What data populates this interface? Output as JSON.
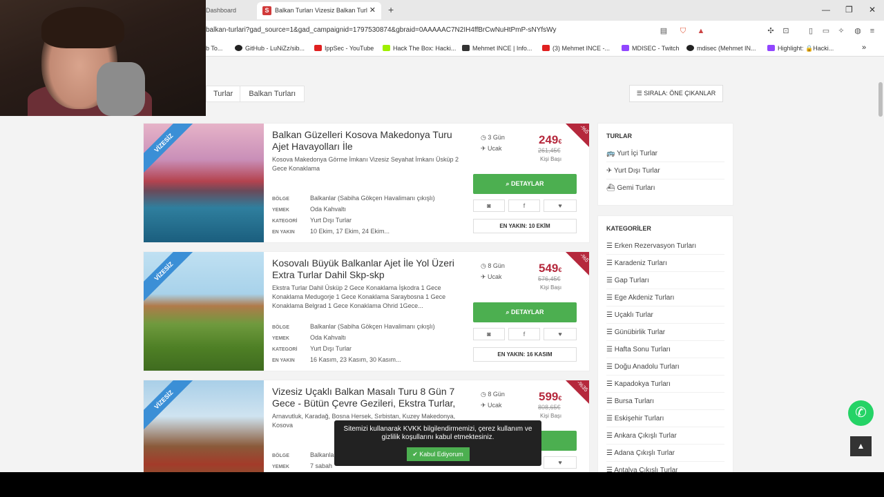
{
  "browser": {
    "tabs": [
      {
        "label": "Dashboard"
      },
      {
        "label": "Balkan Turları Vizesiz Balkan Turl",
        "favicon": "S"
      }
    ],
    "url": "balkan-turlari?gad_source=1&gad_campaignid=1797530874&gbraid=0AAAAAC7N2IH4ffBrCwNuHtPmP-sNYfsWy",
    "bookmarks": [
      "b To...",
      "GitHub - LuNiZz/sib...",
      "IppSec - YouTube",
      "Hack The Box: Hacki...",
      "Mehmet INCE | Info...",
      "(3) Mehmet INCE -...",
      "MDISEC - Twitch",
      "mdisec (Mehmet IN...",
      "Highlight: 🔒Hacki..."
    ]
  },
  "breadcrumb": [
    "Turlar",
    "Balkan Turları"
  ],
  "sort": {
    "label": "SIRALA: ÖNE ÇIKANLAR"
  },
  "tours": [
    {
      "ribbon": "VİZESİZ",
      "title": "Balkan Güzelleri Kosova Makedonya Turu Ajet Havayolları İle",
      "desc": "Kosova Makedonya Görme İmkanı Vizesiz Seyahat İmkanı Üsküp 2 Gece Konaklama",
      "bolge_label": "BÖLGE",
      "bolge": "Balkanlar (Sabiha Gökçen Havalimanı çıkışlı)",
      "yemek_label": "YEMEK",
      "yemek": "Oda Kahvaltı",
      "kategori_label": "KATEGORİ",
      "kategori": "Yurt Dışı Turlar",
      "enyakin_label": "EN YAKIN",
      "enyakin": "10 Ekim, 17 Ekim, 24 Ekim...",
      "days": "3 Gün",
      "transport": "Ucak",
      "price": "249",
      "currency": "€",
      "old_price": "261,45€",
      "per": "Kişi Başı",
      "discount": "-%5",
      "details": "DETAYLAR",
      "nearest": "EN YAKIN: 10 EKİM"
    },
    {
      "ribbon": "VİZESİZ",
      "title": "Kosovalı Büyük Balkanlar Ajet İle Yol Üzeri Extra Turlar Dahil Skp-skp",
      "desc": "Ekstra Turlar Dahil Üsküp 2 Gece Konaklama İşkodra 1 Gece Konaklama Medugorje 1 Gece Konaklama Saraybosna 1 Gece Konaklama Belgrad 1 Gece Konaklama Ohrid 1Gece...",
      "bolge_label": "BÖLGE",
      "bolge": "Balkanlar (Sabiha Gökçen Havalimanı çıkışlı)",
      "yemek_label": "YEMEK",
      "yemek": "Oda Kahvaltı",
      "kategori_label": "KATEGORİ",
      "kategori": "Yurt Dışı Turlar",
      "enyakin_label": "EN YAKIN",
      "enyakin": "16 Kasım, 23 Kasım, 30 Kasım...",
      "days": "8 Gün",
      "transport": "Ucak",
      "price": "549",
      "currency": "€",
      "old_price": "576,45€",
      "per": "Kişi Başı",
      "discount": "-%5",
      "details": "DETAYLAR",
      "nearest": "EN YAKIN: 16 KASIM"
    },
    {
      "ribbon": "VİZESİZ",
      "title": "Vizesiz Uçaklı Balkan Masalı Turu 8 Gün 7 Gece - Bütün Çevre Gezileri, Ekstra Turlar,",
      "desc": "Arnavutluk, Karadağ, Bosna Hersek, Sırbistan, Kuzey Makedonya, Kosova",
      "bolge_label": "BÖLGE",
      "bolge": "Balkanlar",
      "yemek_label": "YEMEK",
      "yemek": "7 sabah",
      "days": "8 Gün",
      "transport": "Ucak",
      "price": "599",
      "currency": "€",
      "old_price": "808,65€",
      "per": "Kişi Başı",
      "discount": "-%35"
    }
  ],
  "sidebar": {
    "turlar_title": "TURLAR",
    "turlar": [
      "Yurt İçi Turlar",
      "Yurt Dışı Turlar",
      "Gemi Turları"
    ],
    "kategoriler_title": "KATEGORİLER",
    "kategoriler": [
      "Erken Rezervasyon Turları",
      "Karadeniz Turları",
      "Gap Turları",
      "Ege Akdeniz Turları",
      "Uçaklı Turlar",
      "Günübirlik Turlar",
      "Hafta Sonu Turları",
      "Doğu Anadolu Turları",
      "Kapadokya Turları",
      "Bursa Turları",
      "Eskişehir Turları",
      "Ankara Çıkışlı Turlar",
      "Adana Çıkışlı Turlar",
      "Antalya Çıkışlı Turlar"
    ]
  },
  "cookie": {
    "text": "Sitemizi kullanarak KVKK bilgilendirmemizi, çerez kullanım ve gizlilik koşullarını kabul etmektesiniz.",
    "accept": "Kabul Ediyorum"
  },
  "colors": {
    "accent": "#b5283c",
    "green": "#4caf50",
    "ribbon": "#3b8fd6"
  }
}
